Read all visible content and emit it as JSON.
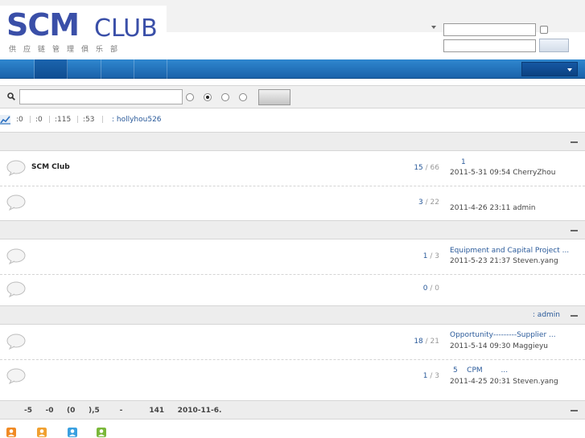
{
  "header": {
    "logo_main": "SCM",
    "logo_club": "CLUB",
    "logo_tagline": "供应链管理俱乐部"
  },
  "stats": [
    ":0",
    ":0",
    ":115",
    ":53"
  ],
  "stats_user": ": hollyhou526",
  "categories": [
    {
      "moderator": "",
      "forums": [
        {
          "name": "SCM Club",
          "topics": "15",
          "posts": "66",
          "last_title": "1",
          "last_meta": "2011-5-31 09:54 CherryZhou"
        },
        {
          "name": "",
          "topics": "3",
          "posts": "22",
          "last_title": "",
          "last_meta": "2011-4-26 23:11 admin"
        }
      ]
    },
    {
      "moderator": "",
      "forums": [
        {
          "name": "",
          "topics": "1",
          "posts": "3",
          "last_title": "Equipment and Capital Project ...",
          "last_meta": "2011-5-23 21:37 Steven.yang"
        },
        {
          "name": "",
          "topics": "0",
          "posts": "0",
          "last_title": "",
          "last_meta": ""
        }
      ]
    },
    {
      "moderator": ": admin",
      "forums": [
        {
          "name": "",
          "topics": "18",
          "posts": "21",
          "last_title": "Opportunity---------Supplier ...",
          "last_meta": "2011-5-14 09:30 Maggieyu"
        },
        {
          "name": "",
          "topics": "1",
          "posts": "3",
          "last_title": "5    CPM        ...",
          "last_meta": "2011-4-25 20:31 Steven.yang"
        }
      ]
    }
  ],
  "footer": {
    "online_text": "-5    -0    (0    ),5      -        141    2010-11-6."
  },
  "colors": {
    "nav": "#1f6fbd",
    "link": "#2a5a9a",
    "legend": [
      "#f08a24",
      "#f0a030",
      "#3aa0e0",
      "#7ab83a"
    ]
  }
}
